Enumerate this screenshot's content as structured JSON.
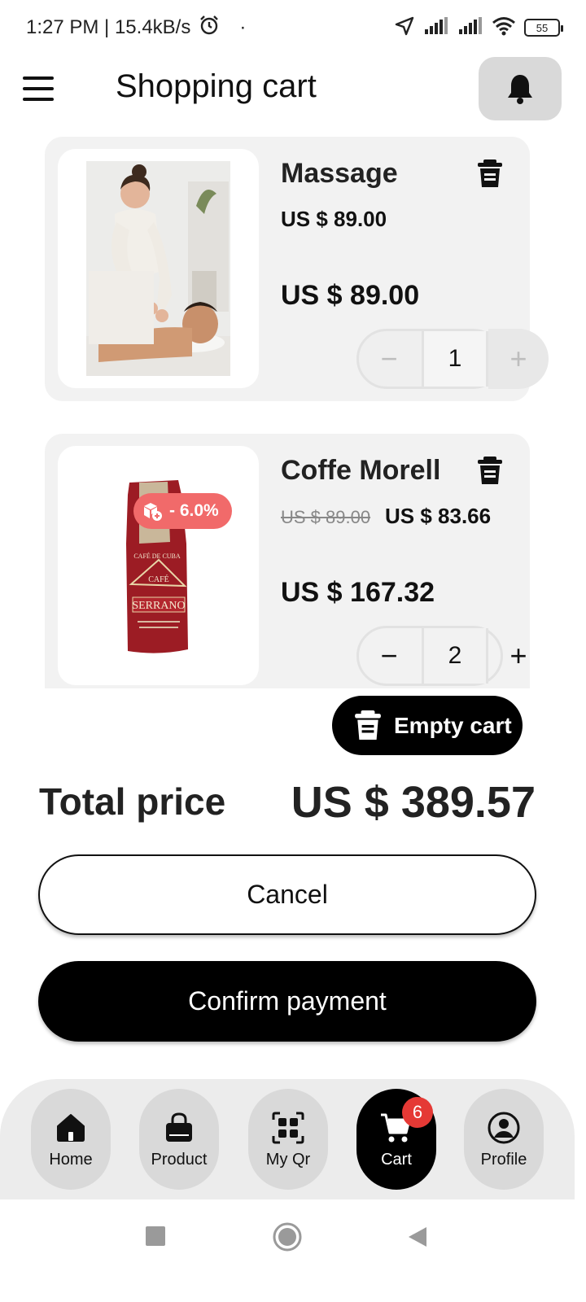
{
  "status_bar": {
    "time_speed": "1:27 PM | 15.4kB/s",
    "dot": "·",
    "battery": "55"
  },
  "header": {
    "title": "Shopping cart"
  },
  "cart": {
    "items": [
      {
        "name": "Massage",
        "unit_price": "US $ 89.00",
        "subtotal": "US $ 89.00",
        "quantity": "1",
        "minus": "−",
        "plus": "+"
      },
      {
        "name": "Coffe Morell",
        "old_price": "US $ 89.00",
        "unit_price": "US $ 83.66",
        "discount": "- 6.0%",
        "subtotal": "US $ 167.32",
        "quantity": "2",
        "minus": "−",
        "plus": "+",
        "package_text": {
          "brand": "CAFÉ",
          "name": "SERRANO",
          "origin": "CAFÉ DE CUBA"
        }
      }
    ],
    "empty_cart_label": "Empty cart"
  },
  "totals": {
    "label": "Total price",
    "value": "US $ 389.57"
  },
  "actions": {
    "cancel": "Cancel",
    "confirm": "Confirm payment"
  },
  "bottom_nav": {
    "items": [
      {
        "label": "Home",
        "icon": "home-icon"
      },
      {
        "label": "Product",
        "icon": "bag-icon"
      },
      {
        "label": "My Qr",
        "icon": "qr-icon"
      },
      {
        "label": "Cart",
        "icon": "cart-icon",
        "badge": "6",
        "active": true
      },
      {
        "label": "Profile",
        "icon": "profile-icon"
      }
    ]
  },
  "colors": {
    "accent": "#000000",
    "discount": "#f16a6a",
    "badge": "#e53935",
    "card": "#f2f2f2"
  }
}
